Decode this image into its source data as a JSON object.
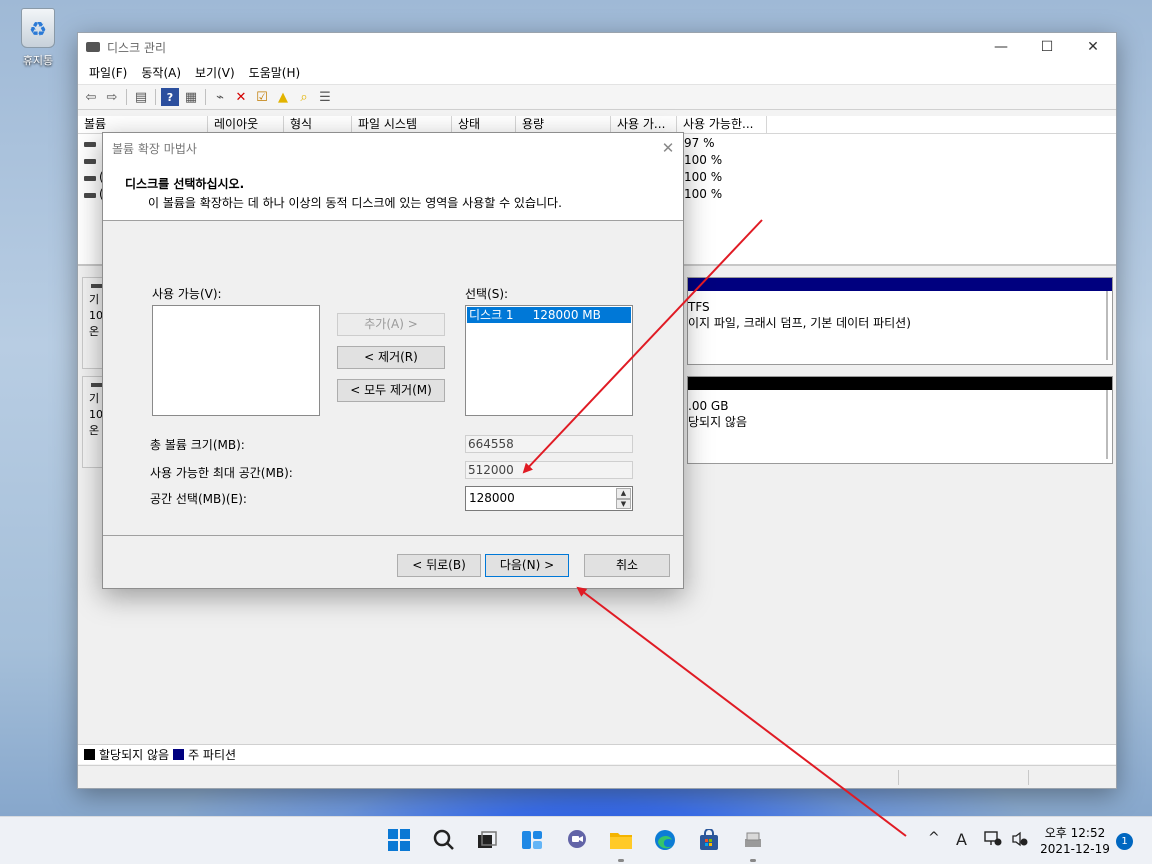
{
  "desktop": {
    "recycle_bin_label": "휴지통"
  },
  "window": {
    "title": "디스크 관리",
    "controls": {
      "minimize": "—",
      "maximize": "☐",
      "close": "✕"
    },
    "menu": [
      "파일(F)",
      "동작(A)",
      "보기(V)",
      "도움말(H)"
    ],
    "toolbar_icons": [
      "back-arrow-icon",
      "forward-arrow-icon",
      "console-tree-icon",
      "help-icon",
      "properties-icon",
      "connect-icon",
      "delete-icon",
      "check-icon",
      "up-folder-icon",
      "search-folder-icon",
      "list-view-icon"
    ],
    "columns": [
      "볼륨",
      "레이아웃",
      "형식",
      "파일 시스템",
      "상태",
      "용량",
      "사용 가...",
      "사용 가능한..."
    ],
    "volume_rows": [
      {
        "label": "",
        "pct": "97 %"
      },
      {
        "label": "",
        "pct": "100 %"
      },
      {
        "label": "(",
        "pct": "100 %"
      },
      {
        "label": "(",
        "pct": "100 %"
      }
    ],
    "disks": [
      {
        "info_lines": [
          "기",
          "10",
          "온"
        ],
        "part_line1": "TFS",
        "part_line2": "이지 파일, 크래시 덤프, 기본 데이터 파티션)",
        "bar_color": "#00007f"
      },
      {
        "info_lines": [
          "기",
          "10",
          "온"
        ],
        "part_line1": ".00 GB",
        "part_line2": "당되지 않음",
        "bar_color": "#000000"
      }
    ],
    "legend": {
      "unallocated": "할당되지 않음",
      "primary": "주 파티션",
      "unallocated_color": "#000000",
      "primary_color": "#00007f"
    }
  },
  "dialog": {
    "title": "볼륨 확장 마법사",
    "close": "✕",
    "heading": "디스크를 선택하십시오.",
    "subheading": "이 볼륨을 확장하는 데 하나 이상의 동적 디스크에 있는 영역을 사용할 수 있습니다.",
    "available_label": "사용 가능(V):",
    "selected_label": "선택(S):",
    "selected_items": [
      "디스크 1     128000 MB"
    ],
    "add_button": "추가(A) >",
    "remove_button": "< 제거(R)",
    "remove_all_button": "< 모두 제거(M)",
    "total_size_label": "총 볼륨 크기(MB):",
    "total_size_value": "664558",
    "max_space_label": "사용 가능한 최대 공간(MB):",
    "max_space_value": "512000",
    "select_space_label": "공간 선택(MB)(E):",
    "select_space_value": "128000",
    "back_button": "< 뒤로(B)",
    "next_button": "다음(N) >",
    "cancel_button": "취소"
  },
  "taskbar": {
    "apps": [
      "windows-start-icon",
      "search-icon",
      "task-view-icon",
      "widgets-icon",
      "chat-icon",
      "file-explorer-icon",
      "edge-icon",
      "store-icon",
      "disk-management-icon"
    ],
    "tray": {
      "chevron": "^",
      "ime": "A"
    },
    "time": "오후 12:52",
    "date": "2021-12-19",
    "notification_count": "1"
  },
  "annotation_color": "#e01b24"
}
